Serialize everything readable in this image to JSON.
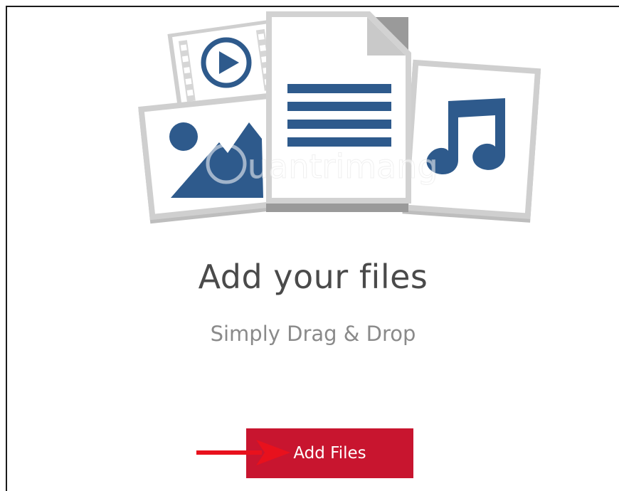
{
  "upload": {
    "title": "Add your files",
    "subtitle": "Simply Drag & Drop",
    "button_label": "Add Files"
  },
  "watermark": {
    "text": "uantrimang"
  },
  "icons": [
    "video-file-icon",
    "image-file-icon",
    "document-file-icon",
    "audio-file-icon",
    "pointer-arrow-icon"
  ],
  "colors": {
    "accent": "#c8152f",
    "icon_blue": "#2e5a8c",
    "arrow_red": "#e8111d",
    "title_text": "#4a4a4a",
    "subtitle_text": "#8a8a8a"
  }
}
